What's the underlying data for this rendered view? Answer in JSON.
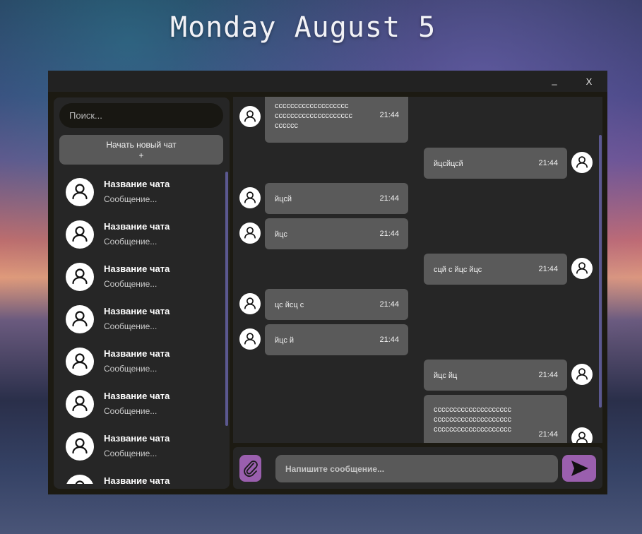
{
  "desktop": {
    "date": "Monday August 5"
  },
  "window": {
    "minimize_label": "_",
    "close_label": "X"
  },
  "sidebar": {
    "search_placeholder": "Поиск...",
    "new_chat_label": "Начать новый чат",
    "new_chat_plus": "+",
    "chats": [
      {
        "name": "Название чата",
        "preview": "Сообщение..."
      },
      {
        "name": "Название чата",
        "preview": "Сообщение..."
      },
      {
        "name": "Название чата",
        "preview": "Сообщение..."
      },
      {
        "name": "Название чата",
        "preview": "Сообщение..."
      },
      {
        "name": "Название чата",
        "preview": "Сообщение..."
      },
      {
        "name": "Название чата",
        "preview": "Сообщение..."
      },
      {
        "name": "Название чата",
        "preview": "Сообщение..."
      },
      {
        "name": "Название чата",
        "preview": ""
      }
    ]
  },
  "messages": [
    {
      "side": "left",
      "text": "ccccccccccccccccccc\ncccccccccccccccccccc\ncccccc",
      "time": "21:44"
    },
    {
      "side": "right",
      "text": "йцсйцсй",
      "time": "21:44"
    },
    {
      "side": "left",
      "text": "йцсй",
      "time": "21:44"
    },
    {
      "side": "left",
      "text": "йцс",
      "time": "21:44"
    },
    {
      "side": "right",
      "text": "сцй с йцс йцс",
      "time": "21:44"
    },
    {
      "side": "left",
      "text": "цс йсц с",
      "time": "21:44"
    },
    {
      "side": "left",
      "text": "йцс й",
      "time": "21:44"
    },
    {
      "side": "right",
      "text": "йцс йц",
      "time": "21:44"
    },
    {
      "side": "right",
      "text": "cccccccccccccccccccc\ncccccccccccccccccccc\ncccccccccccccccccccc",
      "time": "21:44"
    }
  ],
  "composer": {
    "placeholder": "Напишите сообщение..."
  },
  "colors": {
    "accent": "#9a5fae",
    "scrollbar": "#5b5890",
    "bubble": "#5a5a5a",
    "panel": "#262626"
  }
}
